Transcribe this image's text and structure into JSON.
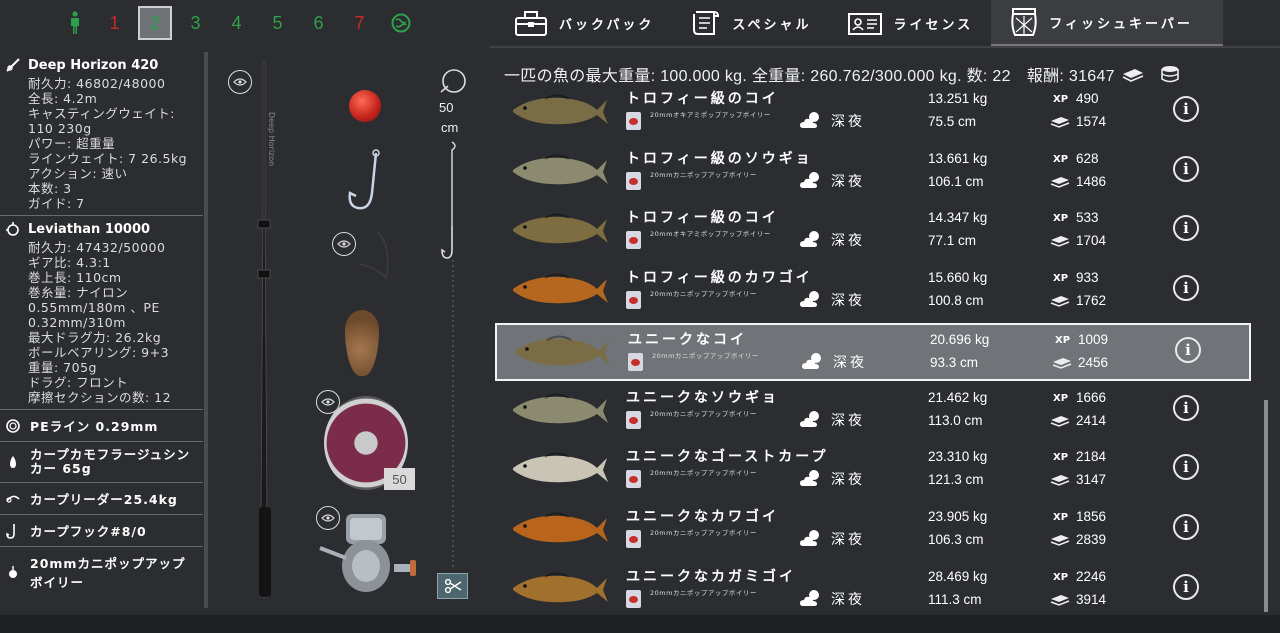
{
  "slots": {
    "items": [
      "1",
      "2",
      "3",
      "4",
      "5",
      "6",
      "7"
    ],
    "active": "2"
  },
  "rod": {
    "name": "Deep Horizon 420",
    "lines": [
      "耐久力: 46802/48000",
      "全長: 4.2m",
      "キャスティングウェイト: 110 230g",
      "パワー: 超重量",
      "ラインウェイト: 7 26.5kg",
      "アクション: 速い",
      "本数: 3",
      "ガイド: 7"
    ]
  },
  "reel": {
    "name": "Leviathan 10000",
    "lines": [
      "耐久力: 47432/50000",
      "ギア比: 4.3:1",
      "巻上長: 110cm",
      "巻糸量: ナイロン 0.55mm/180m 、PE 0.32mm/310m",
      "最大ドラグ力: 26.2kg",
      "ボールベアリング: 9+3",
      "重量: 705g",
      "ドラグ: フロント",
      "摩擦セクションの数: 12"
    ]
  },
  "tackle": {
    "line": "PEライン 0.29mm",
    "sinker": "カープカモフラージュシンカー 65g",
    "leader": "カープリーダー25.4kg",
    "hook": "カープフック#8/0",
    "bait": "20mmカニポップアップボイリー"
  },
  "rig": {
    "depth_value": "50",
    "depth_unit": "cm",
    "line_count": "50"
  },
  "tabs": [
    {
      "label": "バックパック",
      "icon": "toolbox-icon"
    },
    {
      "label": "スペシャル",
      "icon": "scroll-icon"
    },
    {
      "label": "ライセンス",
      "icon": "license-icon"
    },
    {
      "label": "フィッシュキーパー",
      "icon": "fish-keeper-icon"
    }
  ],
  "summary": {
    "text": "一匹の魚の最大重量: 100.000 kg. 全重量: 260.762/300.000 kg. 数: 22",
    "reward_label": "報酬: 31647"
  },
  "fish": [
    {
      "name": "トロフィー級のコイ",
      "bait": "20mmオキアミポップアップボイリー",
      "time": "深夜",
      "weight": "13.251 kg",
      "length": "75.5 cm",
      "xp": "490",
      "money": "1574",
      "color": "#7a6d45"
    },
    {
      "name": "トロフィー級のソウギョ",
      "bait": "20mmカニポップアップボイリー",
      "time": "深夜",
      "weight": "13.661 kg",
      "length": "106.1 cm",
      "xp": "628",
      "money": "1486",
      "color": "#8c8a6e"
    },
    {
      "name": "トロフィー級のコイ",
      "bait": "20mmオキアミポップアップボイリー",
      "time": "深夜",
      "weight": "14.347 kg",
      "length": "77.1 cm",
      "xp": "533",
      "money": "1704",
      "color": "#7d6d40"
    },
    {
      "name": "トロフィー級のカワゴイ",
      "bait": "20mmカニポップアップボイリー",
      "time": "深夜",
      "weight": "15.660 kg",
      "length": "100.8 cm",
      "xp": "933",
      "money": "1762",
      "color": "#b5661f"
    },
    {
      "name": "ユニークなコイ",
      "bait": "20mmカニポップアップボイリー",
      "time": "深夜",
      "weight": "20.696 kg",
      "length": "93.3 cm",
      "xp": "1009",
      "money": "2456",
      "color": "#7a6d45"
    },
    {
      "name": "ユニークなソウギョ",
      "bait": "20mmカニポップアップボイリー",
      "time": "深夜",
      "weight": "21.462 kg",
      "length": "113.0 cm",
      "xp": "1666",
      "money": "2414",
      "color": "#8c8a6e"
    },
    {
      "name": "ユニークなゴーストカープ",
      "bait": "20mmカニポップアップボイリー",
      "time": "深夜",
      "weight": "23.310 kg",
      "length": "121.3 cm",
      "xp": "2184",
      "money": "3147",
      "color": "#c9c4b4"
    },
    {
      "name": "ユニークなカワゴイ",
      "bait": "20mmカニポップアップボイリー",
      "time": "深夜",
      "weight": "23.905 kg",
      "length": "106.3 cm",
      "xp": "1856",
      "money": "2839",
      "color": "#b8641c"
    },
    {
      "name": "ユニークなカガミゴイ",
      "bait": "20mmカニポップアップボイリー",
      "time": "深夜",
      "weight": "28.469 kg",
      "length": "111.3 cm",
      "xp": "2246",
      "money": "3914",
      "color": "#a2702d"
    }
  ],
  "selected_index": 4,
  "xp_label": "XP"
}
